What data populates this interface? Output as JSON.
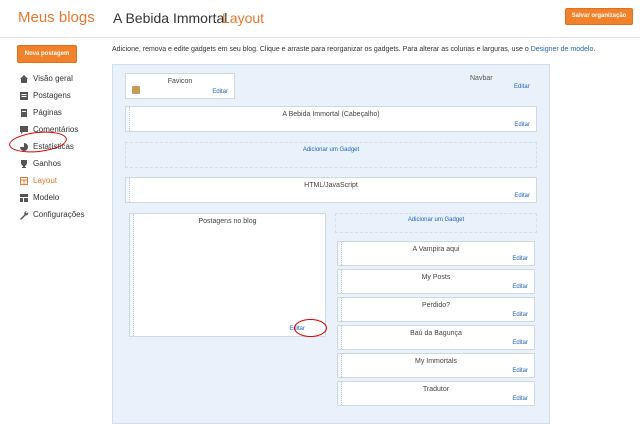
{
  "header": {
    "brand": "Meus blogs",
    "blog_title": "A Bebida Immortal",
    "separator": "·",
    "section": "Layout",
    "save_label": "Salvar organização"
  },
  "sidebar": {
    "new_post": "Nova postagem",
    "items": [
      {
        "label": "Visão geral",
        "icon": "home-icon"
      },
      {
        "label": "Postagens",
        "icon": "posts-icon"
      },
      {
        "label": "Páginas",
        "icon": "pages-icon"
      },
      {
        "label": "Comentários",
        "icon": "comments-icon"
      },
      {
        "label": "Estatísticas",
        "icon": "stats-icon"
      },
      {
        "label": "Ganhos",
        "icon": "trophy-icon"
      },
      {
        "label": "Layout",
        "icon": "layout-icon",
        "active": true
      },
      {
        "label": "Modelo",
        "icon": "template-icon"
      },
      {
        "label": "Configurações",
        "icon": "wrench-icon"
      }
    ]
  },
  "description": {
    "text": "Adicione, remova e edite gadgets em seu blog. Clique e arraste para reorganizar os gadgets. Para alterar as colunas e larguras, use o ",
    "link": "Designer de modelo",
    "end": "."
  },
  "layout": {
    "favicon": {
      "title": "Favicon",
      "edit": "Editar"
    },
    "navbar": {
      "title": "Navbar",
      "edit": "Editar"
    },
    "header": {
      "title": "A Bebida Immortal (Cabeçalho)",
      "edit": "Editar"
    },
    "add_gadget_top": "Adicionar um Gadget",
    "html_js": {
      "title": "HTML/JavaScript",
      "edit": "Editar"
    },
    "posts": {
      "title": "Postagens no blog",
      "edit": "Editar"
    },
    "add_gadget_side": "Adicionar um Gadget",
    "side_gadgets": [
      {
        "title": "A Vampira aqui",
        "edit": "Editar"
      },
      {
        "title": "My Posts",
        "edit": "Editar"
      },
      {
        "title": "Perdido?",
        "edit": "Editar"
      },
      {
        "title": "Baú da Bagunça",
        "edit": "Editar"
      },
      {
        "title": "My Immortals",
        "edit": "Editar"
      },
      {
        "title": "Tradutor",
        "edit": "Editar"
      }
    ]
  },
  "colors": {
    "accent": "#f1822b",
    "link": "#2365b8",
    "annotation": "#dd0000"
  }
}
